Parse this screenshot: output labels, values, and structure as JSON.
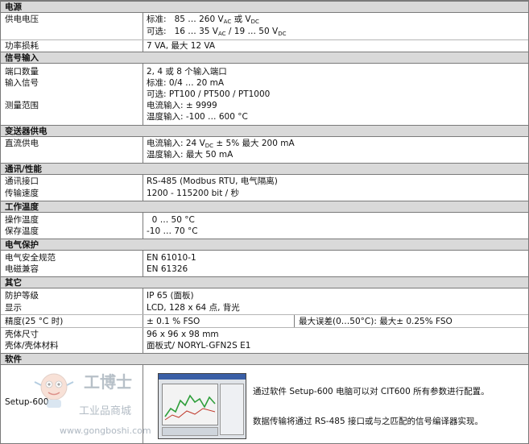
{
  "sections": {
    "power": "电源",
    "signal_input": "信号输入",
    "transmitter_supply": "变送器供电",
    "comm": "通讯/性能",
    "operating_temp": "工作温度",
    "electrical_protection": "电气保护",
    "other": "其它",
    "software": "软件"
  },
  "power": {
    "supply_voltage_label": "供电电压",
    "std_prefix": "标准:",
    "std_value": "85 … 260 V",
    "std_sub_ac": "AC",
    "std_or": "或 V",
    "std_sub_dc": "DC",
    "opt_prefix": "可选:",
    "opt_value": "16 … 35 V",
    "opt_sub_ac": "AC",
    "opt_mid": "/ 19 … 50 V",
    "opt_sub_dc": "DC",
    "consumption_label": "功率损耗",
    "consumption_value": "7 VA,   最大 12 VA"
  },
  "signal": {
    "port_count_label": "端口数量",
    "port_count_value": "2,   4 或 8 个输入端口",
    "input_signal_label": "输入信号",
    "input_std": "标准:    0/4 … 20 mA",
    "input_opt": "可选:    PT100 / PT500 / PT1000",
    "range_label": "测量范围",
    "range_current": "电流输入:  ± 9999",
    "range_temp": "温度输入:  -100 … 600 °C"
  },
  "transmitter": {
    "dc_label": "直流供电",
    "current_prefix": "电流输入:   24 V",
    "current_sub": "DC",
    "current_suffix": "± 5%  最大 200 mA",
    "temp_value": "温度输入:   最大 50 mA"
  },
  "comm": {
    "interface_label": "通讯接口",
    "interface_value": "RS-485 (Modbus RTU, 电气隔离)",
    "speed_label": "传输速度",
    "speed_value": "1200 - 115200 bit / 秒"
  },
  "temps": {
    "operating_label": "操作温度",
    "operating_value": "  0 … 50 °C",
    "storage_label": "保存温度",
    "storage_value": "-10 … 70 °C"
  },
  "protection": {
    "safety_label": "电气安全规范",
    "safety_value": "EN 61010-1",
    "emc_label": "电磁兼容",
    "emc_value": "EN 61326"
  },
  "other": {
    "ip_label": "防护等级",
    "ip_value": "IP 65 (面板)",
    "display_label": "显示",
    "display_value": "LCD, 128 x 64 点, 背光",
    "accuracy_label": "精度(25 °C 时)",
    "accuracy_value": "± 0.1 % FSO",
    "max_error": "最大误差(0…50°C):   最大± 0.25% FSO",
    "size_label": "壳体尺寸",
    "size_value": "96 x 96 x 98 mm",
    "material_label": "壳体/壳体材料",
    "material_value": "面板式/ NORYL-GFN2S E1"
  },
  "software": {
    "name": "Setup-600",
    "desc_1": "通过软件 Setup-600 电脑可以对 CIT600 所有参数进行配置。",
    "desc_2": "数据传输将通过 RS-485 接口或与之匹配的信号编译器实现。"
  },
  "watermark": {
    "brand": "工博士",
    "tagline": "工业品商城",
    "url": "www.gongboshi.com"
  },
  "colors": {
    "section_bg": "#d9d9d9",
    "border": "#7a7a7a",
    "chart_green": "#2e9e3a"
  }
}
